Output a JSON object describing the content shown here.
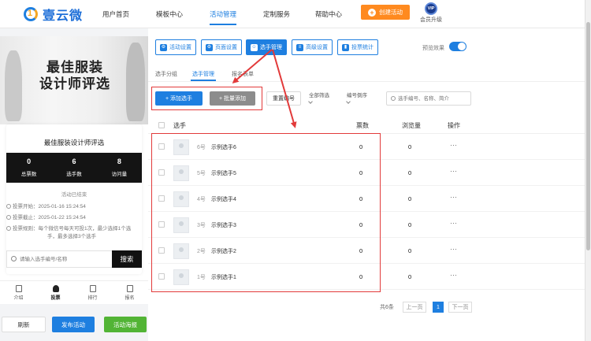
{
  "brand": {
    "logo_num": "1",
    "name": "壹云微"
  },
  "nav": {
    "items": [
      {
        "label": "用户首页"
      },
      {
        "label": "模板中心"
      },
      {
        "label": "活动管理"
      },
      {
        "label": "定制服务"
      },
      {
        "label": "帮助中心"
      }
    ],
    "active_index": 2,
    "create_label": "创建活动",
    "vip_badge": "VIP",
    "vip_label": "会员升级"
  },
  "preview": {
    "banner_title_line1": "最佳服装",
    "banner_title_line2": "设计师评选",
    "card_title": "最佳服装设计师评选",
    "stats": [
      {
        "value": "0",
        "label": "总票数"
      },
      {
        "value": "6",
        "label": "选手数"
      },
      {
        "value": "8",
        "label": "访问量"
      }
    ],
    "voting_status": "活动已结束",
    "info_start": "投票开始：2025-01-16 15:24:54",
    "info_end": "投票截止：2025-01-22 15:24:54",
    "rule_line1": "投票规则：每个微信号每天可投1次，最少选择1个选",
    "rule_line2": "手，最多选择3个选手",
    "search_placeholder": "请输入选手编号/名称",
    "search_button": "搜索",
    "tabs": [
      {
        "label": "介绍"
      },
      {
        "label": "投票"
      },
      {
        "label": "排行"
      },
      {
        "label": "报名"
      }
    ]
  },
  "bottom_buttons": {
    "refresh": "刷新",
    "publish": "发布活动",
    "signup": "活动海报"
  },
  "toolbar": {
    "buttons": [
      {
        "label": "活动设置",
        "icon": "gear-icon",
        "glyph": "⚙"
      },
      {
        "label": "页面设置",
        "icon": "page-icon",
        "glyph": "⚙"
      },
      {
        "label": "选手管理",
        "icon": "user-icon",
        "glyph": "☺"
      },
      {
        "label": "高级设置",
        "icon": "sliders-icon",
        "glyph": "≡"
      },
      {
        "label": "投票统计",
        "icon": "chart-icon",
        "glyph": "▮"
      }
    ],
    "active_index": 2,
    "preview_label": "预览效果"
  },
  "subtabs": [
    {
      "label": "选手分组"
    },
    {
      "label": "选手管理"
    },
    {
      "label": "报名表单"
    }
  ],
  "actions": {
    "add": "+ 添加选手",
    "batch": "+ 批量添加",
    "reset": "重置编号",
    "filter_all": "全部筛选",
    "sort": "编号倒序",
    "search_placeholder": "选手编号、名称、简介"
  },
  "table": {
    "headers": {
      "player": "选手",
      "votes": "票数",
      "views": "浏览量",
      "ops": "操作"
    },
    "rows": [
      {
        "num": "6号",
        "name": "示例选手6",
        "votes": "0",
        "views": "0",
        "ops": "···"
      },
      {
        "num": "5号",
        "name": "示例选手5",
        "votes": "0",
        "views": "0",
        "ops": "···"
      },
      {
        "num": "4号",
        "name": "示例选手4",
        "votes": "0",
        "views": "0",
        "ops": "···"
      },
      {
        "num": "3号",
        "name": "示例选手3",
        "votes": "0",
        "views": "0",
        "ops": "···"
      },
      {
        "num": "2号",
        "name": "示例选手2",
        "votes": "0",
        "views": "0",
        "ops": "···"
      },
      {
        "num": "1号",
        "name": "示例选手1",
        "votes": "0",
        "views": "0",
        "ops": "···"
      }
    ]
  },
  "pagination": {
    "total": "共6条",
    "prev": "上一页",
    "page": "1",
    "next": "下一页"
  },
  "colors": {
    "accent": "#1e7fe0",
    "annotation": "#e23a3a",
    "create": "#ff8a1f",
    "green": "#52b435"
  }
}
